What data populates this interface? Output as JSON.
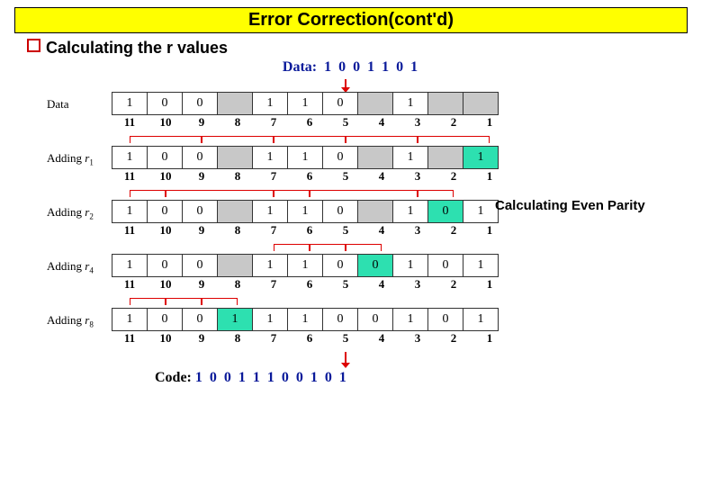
{
  "title": "Error Correction(cont'd)",
  "subheader": "Calculating the r values",
  "data_label": "Data:",
  "data_bits": "1 0 0 1 1 0 1",
  "side_note": "Calculating Even Parity",
  "code_label": "Code:",
  "code_bits": "1 0 0 1 1 1 0 0 1 0 1",
  "positions": [
    "11",
    "10",
    "9",
    "8",
    "7",
    "6",
    "5",
    "4",
    "3",
    "2",
    "1"
  ],
  "rows": [
    {
      "label_html": "Data",
      "cells": [
        {
          "v": "1"
        },
        {
          "v": "0"
        },
        {
          "v": "0"
        },
        {
          "v": "",
          "c": "grey"
        },
        {
          "v": "1"
        },
        {
          "v": "1"
        },
        {
          "v": "0"
        },
        {
          "v": "",
          "c": "grey"
        },
        {
          "v": "1"
        },
        {
          "v": "",
          "c": "grey"
        },
        {
          "v": "",
          "c": "grey"
        }
      ]
    },
    {
      "label_html": "Adding <i>r</i><span class=\"sub\">1</span>",
      "brackets_above": [
        {
          "from": 1,
          "to": 3
        },
        {
          "from": 3,
          "to": 5
        },
        {
          "from": 5,
          "to": 7
        },
        {
          "from": 7,
          "to": 9
        },
        {
          "from": 9,
          "to": 11
        }
      ],
      "cells": [
        {
          "v": "1"
        },
        {
          "v": "0"
        },
        {
          "v": "0"
        },
        {
          "v": "",
          "c": "grey"
        },
        {
          "v": "1"
        },
        {
          "v": "1"
        },
        {
          "v": "0"
        },
        {
          "v": "",
          "c": "grey"
        },
        {
          "v": "1"
        },
        {
          "v": "",
          "c": "grey"
        },
        {
          "v": "1",
          "c": "high"
        }
      ]
    },
    {
      "label_html": "Adding <i>r</i><span class=\"sub\">2</span>",
      "brackets_above": [
        {
          "from": 2,
          "to": 3
        },
        {
          "from": 3,
          "to": 6
        },
        {
          "from": 6,
          "to": 7
        },
        {
          "from": 7,
          "to": 10
        },
        {
          "from": 10,
          "to": 11
        }
      ],
      "cells": [
        {
          "v": "1"
        },
        {
          "v": "0"
        },
        {
          "v": "0"
        },
        {
          "v": "",
          "c": "grey"
        },
        {
          "v": "1"
        },
        {
          "v": "1"
        },
        {
          "v": "0"
        },
        {
          "v": "",
          "c": "grey"
        },
        {
          "v": "1"
        },
        {
          "v": "0",
          "c": "high"
        },
        {
          "v": "1"
        }
      ]
    },
    {
      "label_html": "Adding <i>r</i><span class=\"sub\">4</span>",
      "brackets_above": [
        {
          "from": 4,
          "to": 5
        },
        {
          "from": 5,
          "to": 6
        },
        {
          "from": 6,
          "to": 7
        }
      ],
      "cells": [
        {
          "v": "1"
        },
        {
          "v": "0"
        },
        {
          "v": "0"
        },
        {
          "v": "",
          "c": "grey"
        },
        {
          "v": "1"
        },
        {
          "v": "1"
        },
        {
          "v": "0"
        },
        {
          "v": "0",
          "c": "high"
        },
        {
          "v": "1"
        },
        {
          "v": "0"
        },
        {
          "v": "1"
        }
      ]
    },
    {
      "label_html": "Adding <i>r</i><span class=\"sub\">8</span>",
      "brackets_above": [
        {
          "from": 8,
          "to": 9
        },
        {
          "from": 9,
          "to": 10
        },
        {
          "from": 10,
          "to": 11
        }
      ],
      "cells": [
        {
          "v": "1"
        },
        {
          "v": "0"
        },
        {
          "v": "0"
        },
        {
          "v": "1",
          "c": "high"
        },
        {
          "v": "1"
        },
        {
          "v": "1"
        },
        {
          "v": "0"
        },
        {
          "v": "0"
        },
        {
          "v": "1"
        },
        {
          "v": "0"
        },
        {
          "v": "1"
        }
      ]
    }
  ]
}
